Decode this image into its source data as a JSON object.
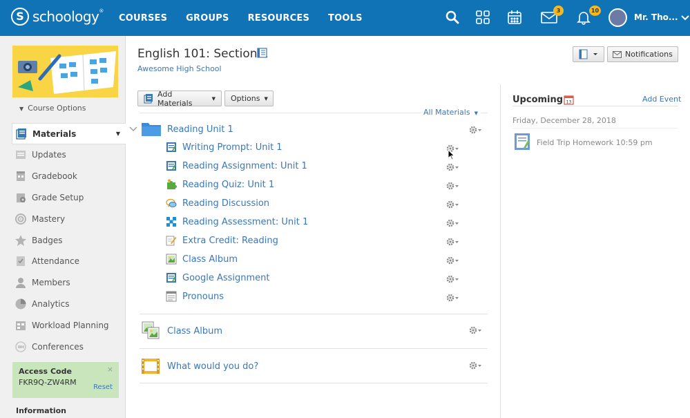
{
  "header": {
    "logo_text": "schoology",
    "logo_tm": "®",
    "nav": [
      "COURSES",
      "GROUPS",
      "RESOURCES",
      "TOOLS"
    ],
    "icons": [
      "search-icon",
      "apps-grid-icon",
      "calendar-icon",
      "mail-icon",
      "bell-icon"
    ],
    "mail_count": "3",
    "notification_count": "10",
    "user_name": "Mr. Tho...",
    "brand_color": "#0f73b6"
  },
  "sidebar": {
    "course_options": "Course Options",
    "items": [
      {
        "label": "Materials",
        "icon": "materials-icon"
      },
      {
        "label": "Updates",
        "icon": "updates-icon"
      },
      {
        "label": "Gradebook",
        "icon": "gradebook-icon"
      },
      {
        "label": "Grade Setup",
        "icon": "grade-setup-icon"
      },
      {
        "label": "Mastery",
        "icon": "mastery-icon"
      },
      {
        "label": "Badges",
        "icon": "badges-icon"
      },
      {
        "label": "Attendance",
        "icon": "attendance-icon"
      },
      {
        "label": "Members",
        "icon": "members-icon"
      },
      {
        "label": "Analytics",
        "icon": "analytics-icon"
      },
      {
        "label": "Workload Planning",
        "icon": "workload-icon"
      },
      {
        "label": "Conferences",
        "icon": "conferences-icon"
      }
    ],
    "access_code": {
      "title": "Access Code",
      "code": "FKR9Q-ZW4RM",
      "reset": "Reset",
      "close": "×"
    },
    "information": "Information"
  },
  "main": {
    "title": "English 101: Section 1",
    "school": "Awesome High School",
    "add_materials": "Add Materials",
    "options": "Options",
    "all_materials": "All Materials",
    "notifications": "Notifications",
    "folder": {
      "title": "Reading Unit 1"
    },
    "items": [
      {
        "title": "Writing Prompt: Unit 1",
        "icon": "assignment-icon"
      },
      {
        "title": "Reading Assignment: Unit 1",
        "icon": "assignment-icon"
      },
      {
        "title": "Reading Quiz: Unit 1",
        "icon": "quiz-icon"
      },
      {
        "title": "Reading Discussion",
        "icon": "discussion-icon"
      },
      {
        "title": "Reading Assessment: Unit 1",
        "icon": "assessment-icon"
      },
      {
        "title": "Extra Credit: Reading",
        "icon": "pencil-icon"
      },
      {
        "title": "Class Album",
        "icon": "album-icon"
      },
      {
        "title": "Google Assignment",
        "icon": "assignment-icon"
      },
      {
        "title": "Pronouns",
        "icon": "page-icon"
      }
    ],
    "top_level": [
      {
        "title": "Class Album",
        "icon": "album-icon"
      },
      {
        "title": "What would you do?",
        "icon": "media-album-icon"
      }
    ]
  },
  "upcoming": {
    "title": "Upcoming",
    "add_event": "Add Event",
    "date": "Friday, December 28, 2018",
    "event": "Field Trip Homework 10:59 pm"
  }
}
